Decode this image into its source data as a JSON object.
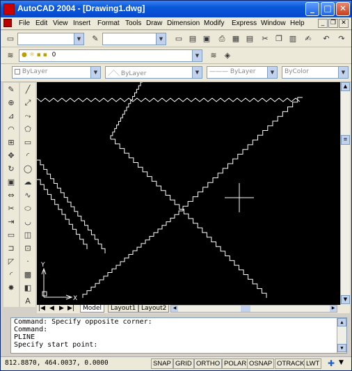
{
  "window": {
    "title": "AutoCAD 2004 - [Drawing1.dwg]",
    "min_glyph": "_",
    "max_glyph": "□",
    "close_glyph": "✕"
  },
  "menu": {
    "items": [
      "File",
      "Edit",
      "View",
      "Insert",
      "Format",
      "Tools",
      "Draw",
      "Dimension",
      "Modify",
      "Express",
      "Window",
      "Help"
    ]
  },
  "layers": {
    "current_layer": "0",
    "color": "ByLayer",
    "linetype": "ByLayer",
    "lineweight": "ByLayer",
    "plotstyle": "ByColor"
  },
  "layout_tabs": [
    "Model",
    "Layout1",
    "Layout2"
  ],
  "command_window": {
    "lines": [
      "Command: Specify opposite corner:",
      "Command:",
      "PLINE",
      "Specify start point:"
    ]
  },
  "status": {
    "coordinates": "812.8870, 464.0037, 0.0000",
    "toggles": [
      "SNAP",
      "GRID",
      "ORTHO",
      "POLAR",
      "OSNAP",
      "OTRACK",
      "LWT"
    ]
  },
  "ucs": {
    "x_label": "X",
    "y_label": "Y"
  },
  "colors": {
    "canvas_bg": "#000000",
    "geometry": "#ffffff",
    "titlebar": "#0548cf"
  }
}
